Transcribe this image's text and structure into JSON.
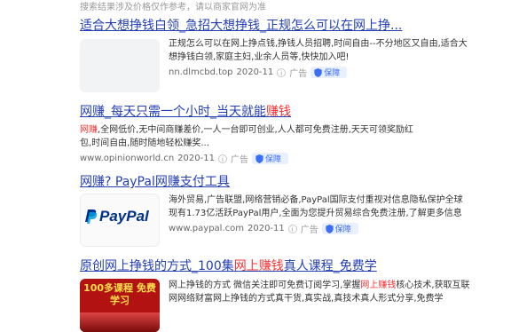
{
  "notice": "搜索结果涉及价格仅作参考，请以商家官网为准",
  "results": [
    {
      "title_parts": [
        "适合大想挣钱白领_急招大想挣钱_正规怎么可以在网上挣..."
      ],
      "snippet": "正规怎么可以在网上挣点钱,挣钱人员招聘,时间自由--不分地区又自由,适合大想挣钱白领,家庭主妇,业余人员等,快快加入吧!",
      "url": "nn.dlmcbd.top",
      "date": "2020-11",
      "ad_label": "广告",
      "badge": "保障"
    },
    {
      "title_pre": "网赚_每天只需一个小时_当天就能",
      "title_red": "赚钱",
      "snippet_red": "网赚",
      "snippet_rest": ",全网低价,无中间商赚差价,一人一台即可创业,人人都可免费注册,天天可领奖励红包,时间自由,随时随地轻松赚奖...",
      "url": "www.opinionworld.cn",
      "date": "2020-11",
      "ad_label": "广告",
      "badge": "保障"
    },
    {
      "title": "网赚? PayPal网赚支付工具",
      "snippet": "海外贸易,广告联盟,网络营销必备,PayPal国际支付重视对信息隐私保护全球现有1.73亿活跃PayPal用户,全面为您提升贸易综合免费注册,了解更多信息",
      "url": "www.paypal.com",
      "date": "2020-11",
      "ad_label": "广告",
      "badge": "保障",
      "logo_text": "PayPal"
    },
    {
      "title_pre": "原创网上挣钱的方式_100集",
      "title_red": "网上赚钱",
      "title_post": "真人课程_免费学",
      "snippet_pre": "网上挣钱的方式 微信关注即可免费订阅学习,掌握",
      "snippet_red": "网上赚钱",
      "snippet_post": "核心技术,获取互联网网络财富网上挣钱的方式真干货,真实战,真技术真人形式分享,免费学",
      "thumb_text": "100多课程 免费学习"
    }
  ]
}
